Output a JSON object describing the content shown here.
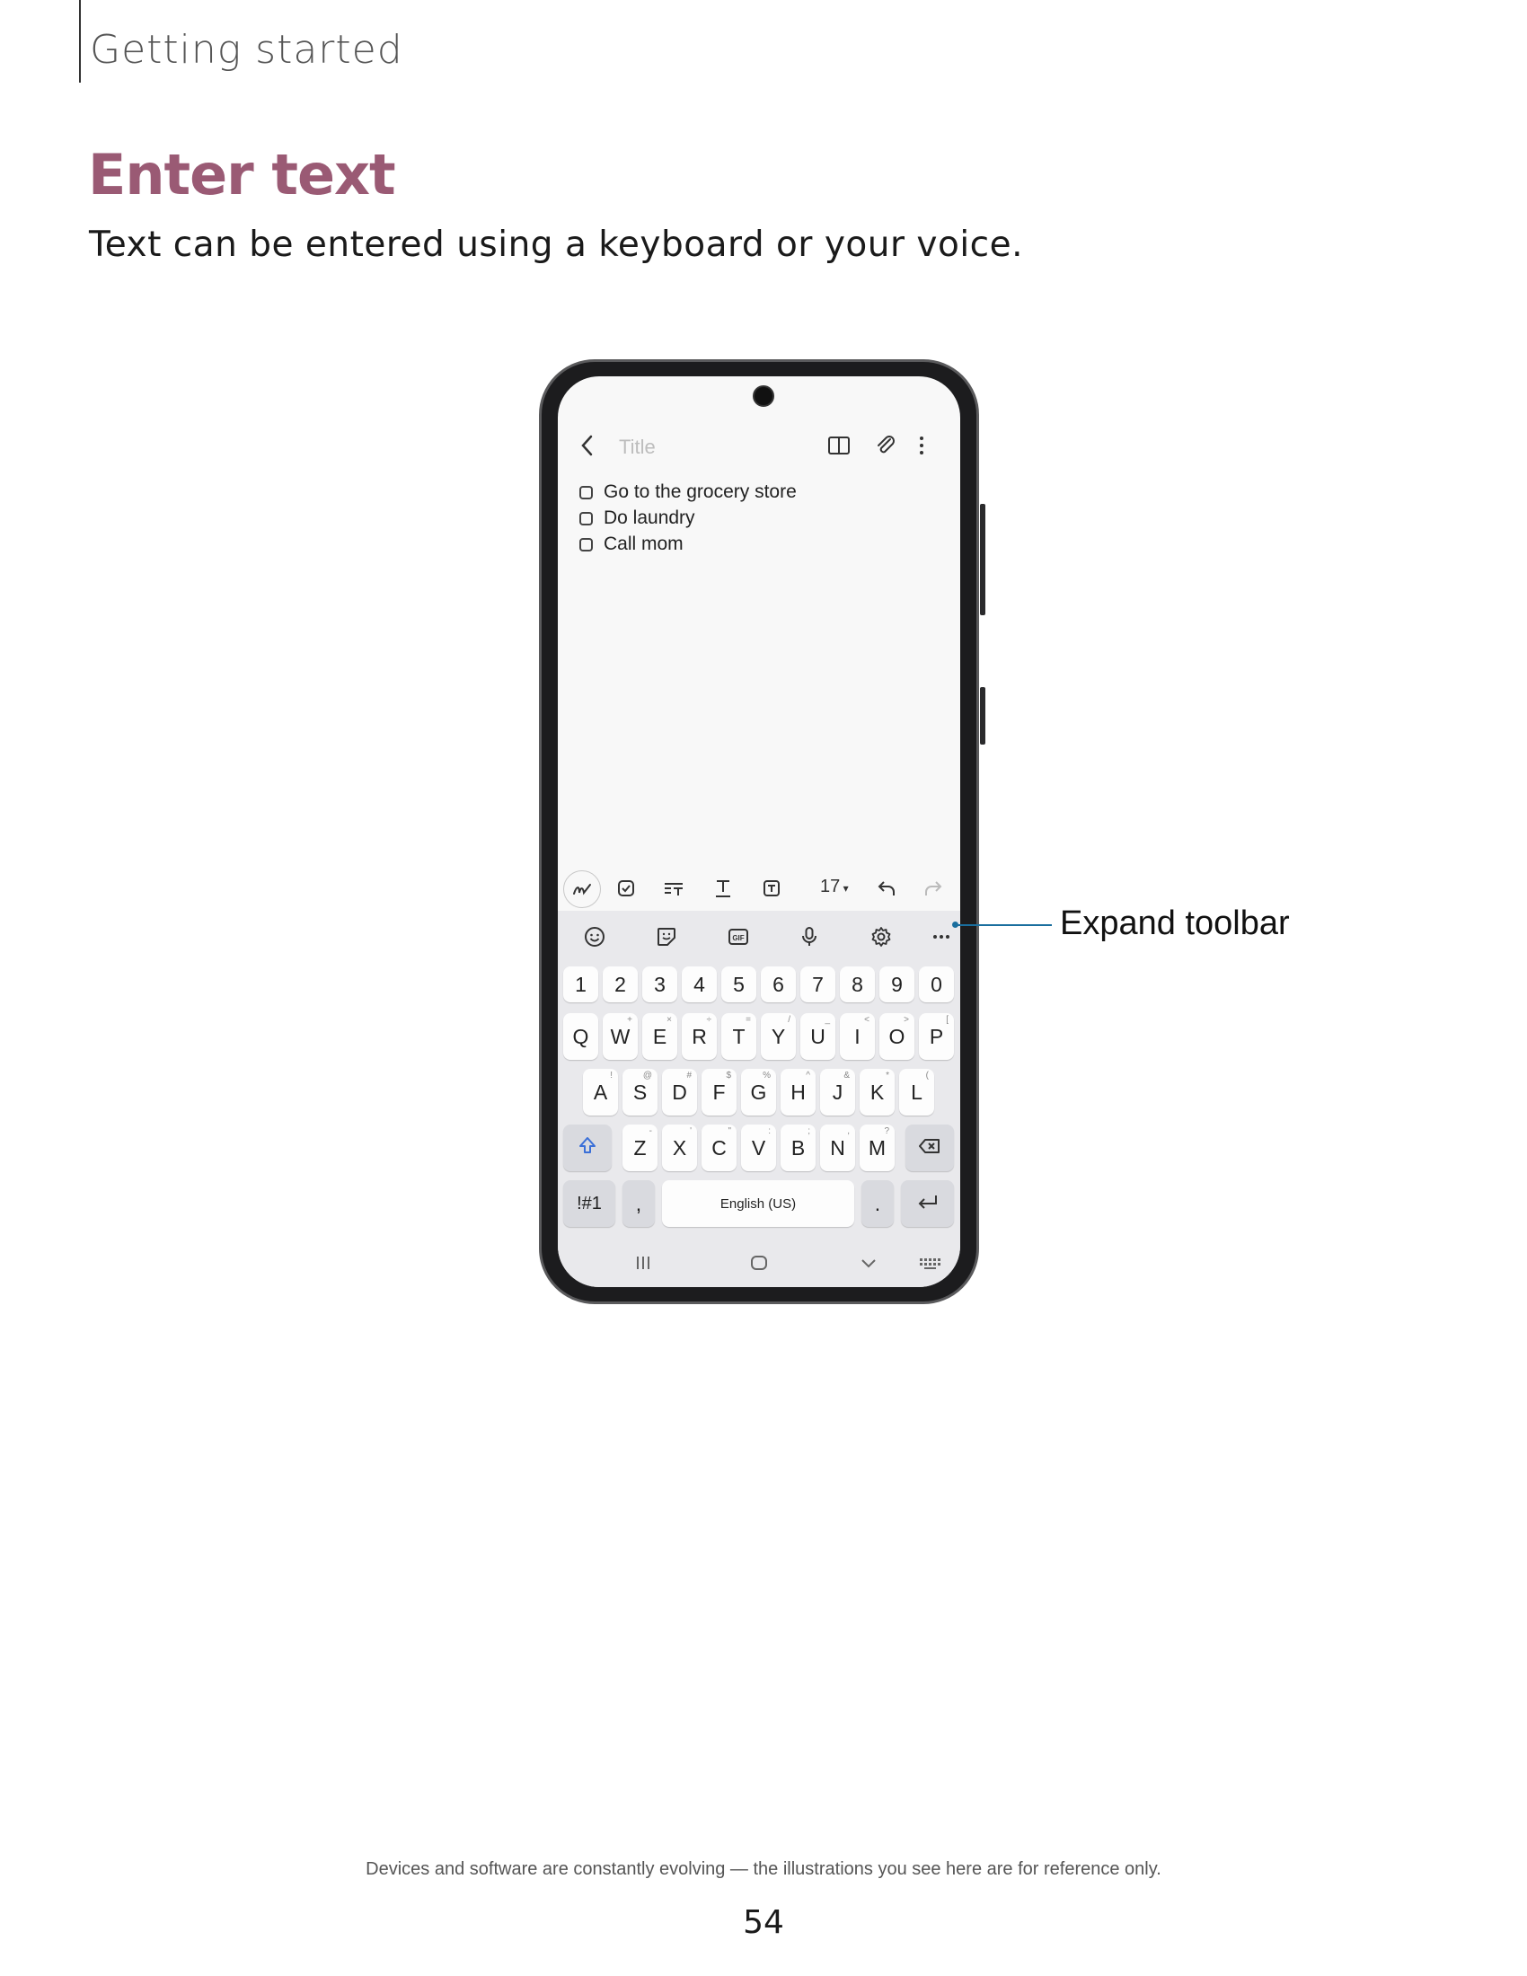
{
  "header": {
    "section": "Getting started"
  },
  "heading": "Enter text",
  "intro": "Text can be entered using a keyboard or your voice.",
  "phone": {
    "title_placeholder": "Title",
    "notes": [
      "Go to the grocery store",
      "Do laundry",
      "Call mom"
    ],
    "toolbar": {
      "font_size": "17"
    },
    "keyboard": {
      "number_row": [
        "1",
        "2",
        "3",
        "4",
        "5",
        "6",
        "7",
        "8",
        "9",
        "0"
      ],
      "row1": [
        {
          "k": "Q",
          "h": ""
        },
        {
          "k": "W",
          "h": "+"
        },
        {
          "k": "E",
          "h": "×"
        },
        {
          "k": "R",
          "h": "÷"
        },
        {
          "k": "T",
          "h": "="
        },
        {
          "k": "Y",
          "h": "/"
        },
        {
          "k": "U",
          "h": "_"
        },
        {
          "k": "I",
          "h": "<"
        },
        {
          "k": "O",
          "h": ">"
        },
        {
          "k": "P",
          "h": "["
        }
      ],
      "row2": [
        {
          "k": "A",
          "h": "!"
        },
        {
          "k": "S",
          "h": "@"
        },
        {
          "k": "D",
          "h": "#"
        },
        {
          "k": "F",
          "h": "$"
        },
        {
          "k": "G",
          "h": "%"
        },
        {
          "k": "H",
          "h": "^"
        },
        {
          "k": "J",
          "h": "&"
        },
        {
          "k": "K",
          "h": "*"
        },
        {
          "k": "L",
          "h": "("
        }
      ],
      "row3": [
        {
          "k": "Z",
          "h": "-"
        },
        {
          "k": "X",
          "h": "'"
        },
        {
          "k": "C",
          "h": "\""
        },
        {
          "k": "V",
          "h": ":"
        },
        {
          "k": "B",
          "h": ";"
        },
        {
          "k": "N",
          "h": ","
        },
        {
          "k": "M",
          "h": "?"
        }
      ],
      "symbols_label": "!#1",
      "comma": ",",
      "space_label": "English (US)",
      "period": "."
    }
  },
  "callout": {
    "label": "Expand toolbar"
  },
  "footer": {
    "disclaimer": "Devices and software are constantly evolving — the illustrations you see here are for reference only.",
    "page_number": "54"
  },
  "colors": {
    "heading": "#9a5a74",
    "callout": "#1a6e9e"
  }
}
